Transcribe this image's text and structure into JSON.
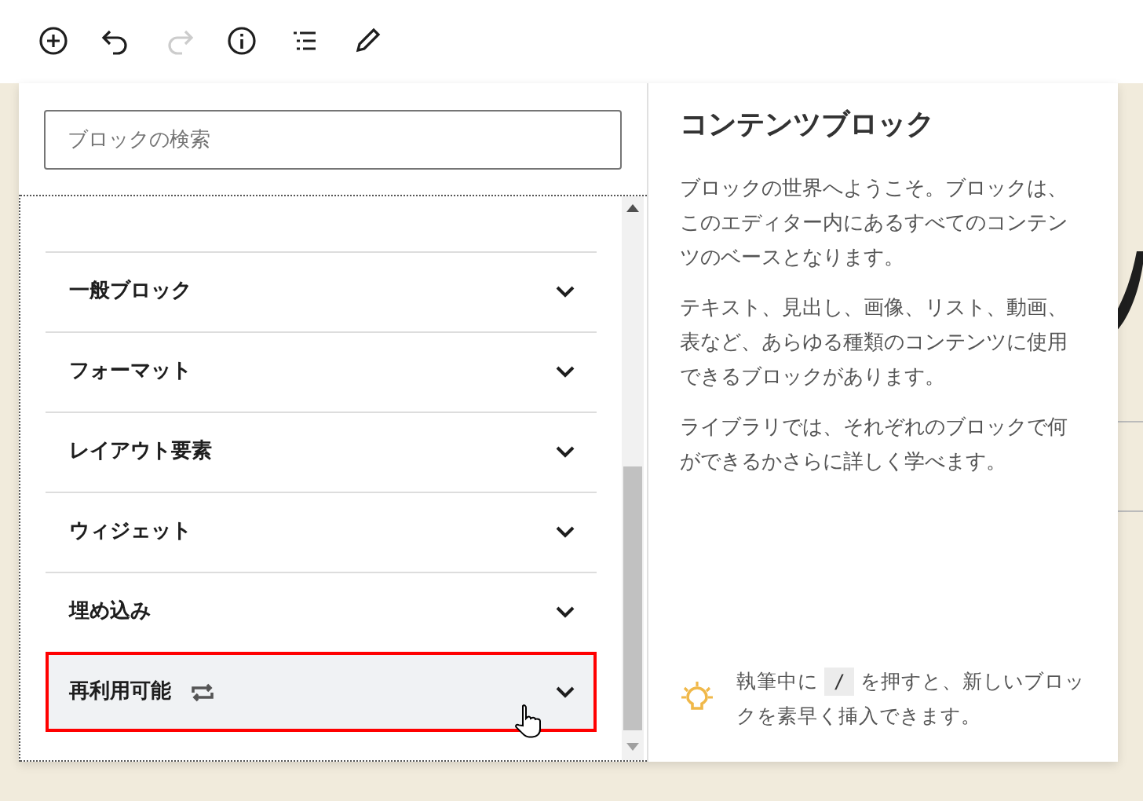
{
  "toolbar": [
    {
      "kind": "add",
      "disabled": false
    },
    {
      "kind": "undo",
      "disabled": false
    },
    {
      "kind": "redo",
      "disabled": true
    },
    {
      "kind": "info",
      "disabled": false
    },
    {
      "kind": "outline",
      "disabled": false
    },
    {
      "kind": "edit",
      "disabled": false
    }
  ],
  "inserter": {
    "search": {
      "placeholder": "ブロックの検索"
    },
    "categories": [
      {
        "label": "一般ブロック",
        "kind": "plain",
        "hovered": false,
        "highlighted": false
      },
      {
        "label": "フォーマット",
        "kind": "plain",
        "hovered": false,
        "highlighted": false
      },
      {
        "label": "レイアウト要素",
        "kind": "plain",
        "hovered": false,
        "highlighted": false
      },
      {
        "label": "ウィジェット",
        "kind": "plain",
        "hovered": false,
        "highlighted": false
      },
      {
        "label": "埋め込み",
        "kind": "plain",
        "hovered": false,
        "highlighted": false
      },
      {
        "label": "再利用可能",
        "kind": "reusable",
        "hovered": true,
        "highlighted": true
      }
    ]
  },
  "help": {
    "title": "コンテンツブロック",
    "paragraphs": [
      "ブロックの世界へようこそ。ブロックは、このエディター内にあるすべてのコンテンツのベースとなります。",
      "テキスト、見出し、画像、リスト、動画、表など、あらゆる種類のコンテンツに使用できるブロックがあります。",
      "ライブラリでは、それぞれのブロックで何ができるかさらに詳しく学べます。"
    ],
    "tip": {
      "before": "執筆中に",
      "key": "/",
      "after": "を押すと、新しいブロックを素早く挿入できます。"
    }
  }
}
